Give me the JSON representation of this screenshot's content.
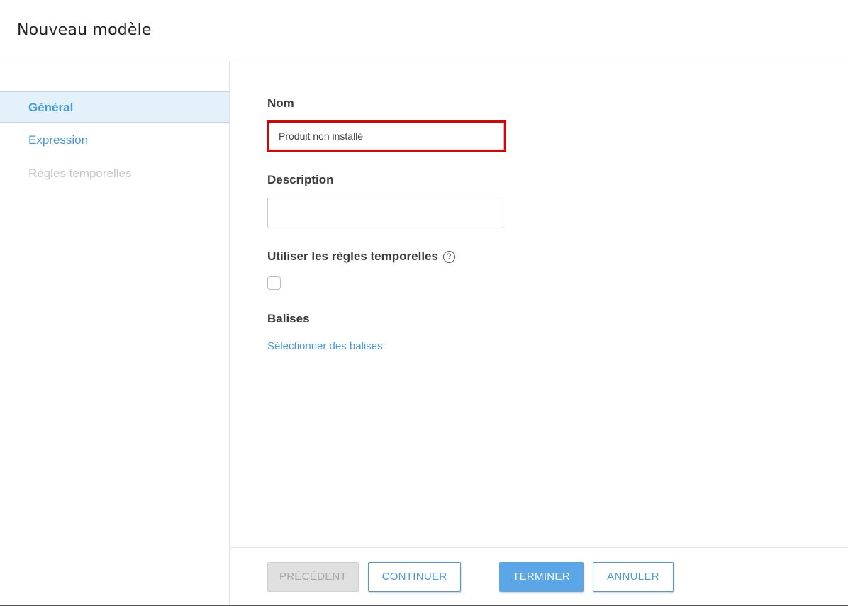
{
  "dialog": {
    "title": "Nouveau modèle"
  },
  "sidebar": {
    "items": [
      {
        "label": "Général",
        "state": "active"
      },
      {
        "label": "Expression",
        "state": "enabled"
      },
      {
        "label": "Règles temporelles",
        "state": "disabled"
      }
    ]
  },
  "form": {
    "name": {
      "label": "Nom",
      "value": "Produit non installé",
      "highlight_color": "#e00000"
    },
    "description": {
      "label": "Description",
      "value": ""
    },
    "time_rules": {
      "label": "Utiliser les règles temporelles",
      "help_icon": "?",
      "checked": false
    },
    "tags": {
      "label": "Balises",
      "link": "Sélectionner des balises"
    }
  },
  "footer": {
    "previous_label": "PRÉCÉDENT",
    "continue_label": "CONTINUER",
    "finish_label": "TERMINER",
    "cancel_label": "ANNULER"
  },
  "colors": {
    "accent": "#4a9ad6",
    "primary_button": "#5ba6e6",
    "active_bg": "#e3f1fb"
  }
}
